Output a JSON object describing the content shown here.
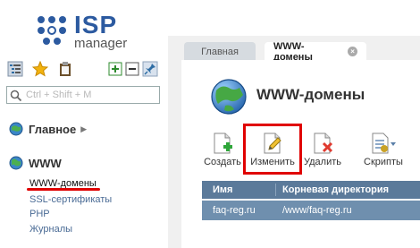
{
  "logo": {
    "primary": "ISP",
    "secondary": "manager",
    "colors": {
      "brand": "#2c5aa0",
      "dots": "#2c5aa0"
    }
  },
  "sidebar": {
    "search_placeholder": "Ctrl + Shift + M",
    "sections": [
      {
        "label": "Главное",
        "icon": "home-globe-icon",
        "collapsed": true
      },
      {
        "label": "WWW",
        "icon": "globe-icon",
        "collapsed": false,
        "items": [
          "WWW-домены",
          "SSL-сертификаты",
          "PHP",
          "Журналы"
        ],
        "active_index": 0
      }
    ]
  },
  "tabs": [
    {
      "label": "Главная",
      "active": false
    },
    {
      "label": "WWW-домены",
      "active": true,
      "close": "×"
    }
  ],
  "main": {
    "title": "WWW-домены",
    "toolbar": [
      {
        "label": "Создать",
        "icon": "create-icon"
      },
      {
        "label": "Изменить",
        "icon": "edit-icon",
        "highlighted": true
      },
      {
        "label": "Удалить",
        "icon": "delete-icon"
      },
      {
        "label": "Скрипты",
        "icon": "scripts-icon"
      }
    ],
    "table": {
      "headers": [
        "Имя",
        "Корневая директория"
      ],
      "rows": [
        [
          "faq-reg.ru",
          "/www/faq-reg.ru"
        ]
      ]
    }
  },
  "colors": {
    "highlight": "#e00000",
    "table_header": "#5b7a9a",
    "selected_row": "#6f8fae",
    "link": "#4a6b95"
  }
}
